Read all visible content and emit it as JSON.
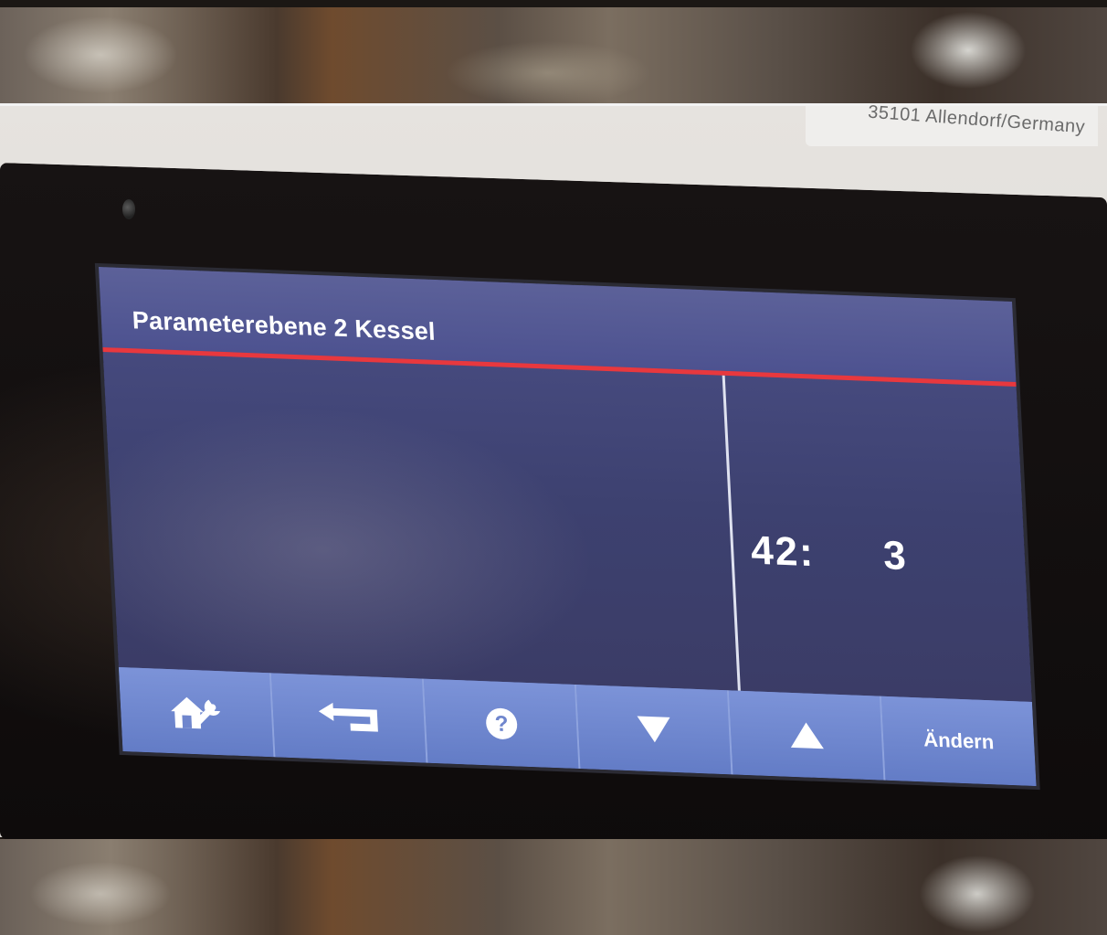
{
  "device": {
    "label_text": "35101 Allendorf/Germany"
  },
  "screen": {
    "title": "Parameterebene 2 Kessel",
    "parameter": {
      "number": "42:",
      "value": "3"
    }
  },
  "buttons": [
    {
      "name": "service-button",
      "icon": "house-wrench-icon",
      "label": ""
    },
    {
      "name": "back-button",
      "icon": "return-arrow-icon",
      "label": ""
    },
    {
      "name": "help-button",
      "icon": "question-mark-icon",
      "label": ""
    },
    {
      "name": "down-button",
      "icon": "triangle-down-icon",
      "label": ""
    },
    {
      "name": "up-button",
      "icon": "triangle-up-icon",
      "label": ""
    },
    {
      "name": "change-button",
      "icon": "",
      "label": "Ändern"
    }
  ],
  "colors": {
    "screen_bg": "#3d4170",
    "header_bg": "#5c6199",
    "accent_line": "#e8383e",
    "button_bar": "#6d86cf",
    "text": "#ffffff"
  }
}
